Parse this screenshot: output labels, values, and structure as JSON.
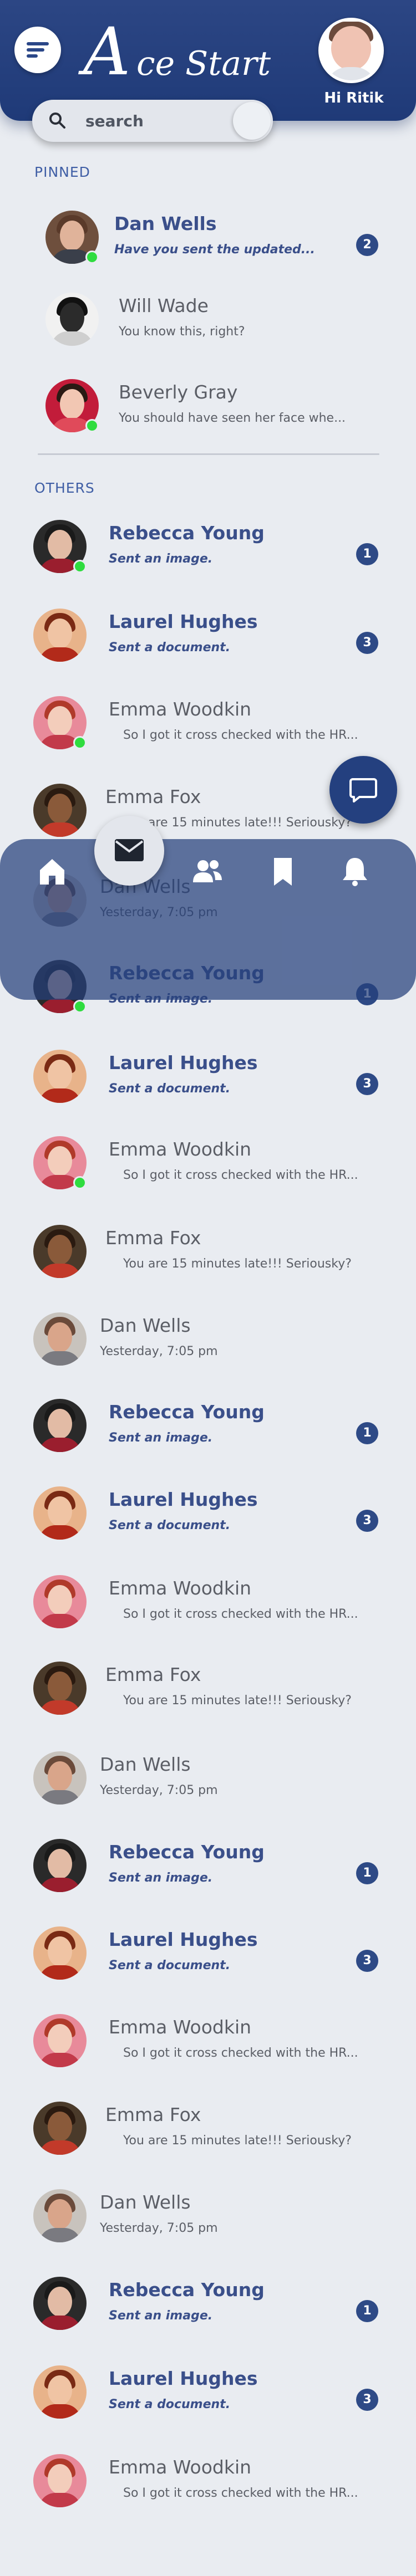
{
  "app": {
    "brand_initial": "A",
    "brand_rest": "ce Start",
    "greeting": "Hi Ritik"
  },
  "search": {
    "placeholder": "search"
  },
  "sections": {
    "pinned": "PINNED",
    "others": "OTHERS"
  },
  "colors": {
    "primary": "#24407f",
    "online": "#2fdc3f",
    "background": "#e9ecf1"
  },
  "pinned": [
    {
      "name": "Dan Wells",
      "message": "Have you sent the updated...",
      "unread": "2",
      "online": true,
      "style": "unread"
    },
    {
      "name": "Will Wade",
      "message": "You know this, right?",
      "unread": "",
      "online": false,
      "style": "read"
    },
    {
      "name": "Beverly Gray",
      "message": "You should have seen her face whe...",
      "unread": "",
      "online": true,
      "style": "read"
    }
  ],
  "others": [
    {
      "name": "Rebecca Young",
      "message": "Sent an image.",
      "unread": "1"
    },
    {
      "name": "Laurel Hughes",
      "message": "Sent a document.",
      "unread": "3"
    },
    {
      "name": "Emma Woodkin",
      "message": "So I got it cross checked with the HR..."
    },
    {
      "name": "Emma Fox",
      "message": "You are 15 minutes late!!! Seriousky?"
    },
    {
      "name": "Dan Wells",
      "message": "Yesterday, 7:05 pm"
    }
  ],
  "nav": {
    "items": [
      "home-icon",
      "mail-icon",
      "contacts-icon",
      "bookmark-icon",
      "bell-icon"
    ],
    "active": "mail-icon"
  },
  "fab": {
    "icon": "chat-bubble-icon"
  }
}
